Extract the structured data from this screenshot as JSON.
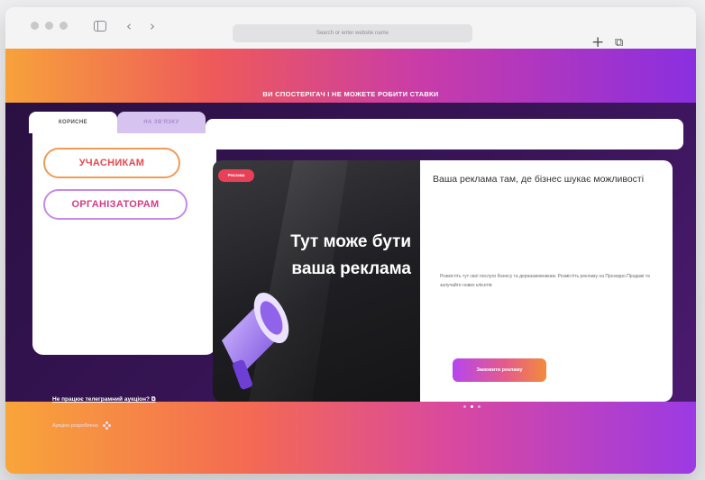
{
  "browser": {
    "address_placeholder": "Search or enter website name",
    "new_tab_icon": "plus-icon",
    "tabs_icon": "tabs-overview-icon"
  },
  "banner": {
    "text": "ВИ СПОСТЕРІГАЧ І НЕ МОЖЕТЕ РОБИТИ СТАВКИ"
  },
  "left_panel": {
    "tab_active": "КОРИСНЕ",
    "tab_inactive": "НА ЗВ'ЯЗКУ",
    "pill_participants": "УЧАСНИКАМ",
    "pill_organizers": "ОРГАНІЗАТОРАМ"
  },
  "ad": {
    "badge": "Реклама",
    "headline": "Тут може бути ваша реклама",
    "title": "Ваша реклама там, де бізнес шукає можливості",
    "description": "Розмістіть тут свої послуги бізнесу та держзамовникам. Розмістіть рекламу на Прозорро.Продажі та залучайте нових клієнтів",
    "button": "Замовити рекламу"
  },
  "footer": {
    "link": "Не працює телеграмний аукціон?",
    "credits": "Аукціон розроблено"
  },
  "colors": {
    "accent_orange": "#f7a23b",
    "accent_pink": "#e94058",
    "accent_purple": "#8a2fe0",
    "body_dark": "#2a1042"
  }
}
